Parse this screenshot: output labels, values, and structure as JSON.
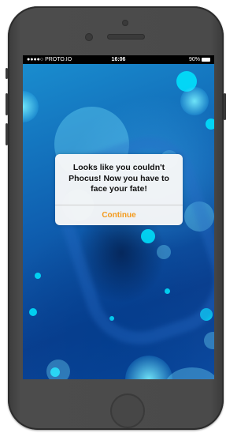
{
  "status_bar": {
    "carrier": "●●●●○ PROTO.IO",
    "time": "16:06",
    "battery": "90%"
  },
  "alert": {
    "message": "Looks like you couldn't Phocus! Now you have to face your fate!",
    "button_label": "Continue"
  },
  "colors": {
    "accent": "#f39a1c",
    "background": "#0f5fb0"
  }
}
